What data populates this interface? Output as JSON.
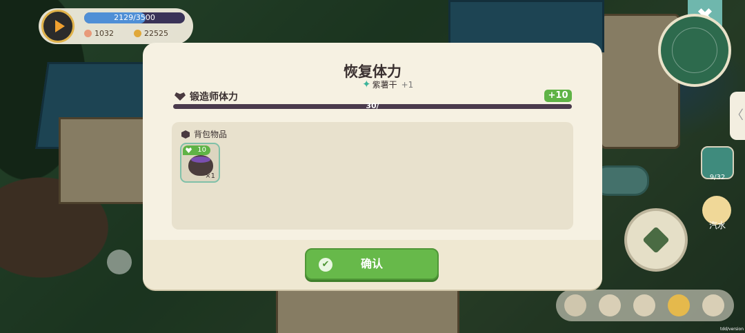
{
  "hud": {
    "exp_text": "2129/3500",
    "exp_progress": 0.608,
    "gems": "1032",
    "coins": "22525"
  },
  "side": {
    "close_symbol": "✖",
    "collapse_symbol": "〈",
    "bag_capacity": "9/32",
    "soda_label": "汽水"
  },
  "modal": {
    "title": "恢复体力",
    "toast_item": "紫薯干",
    "toast_plus": "+1",
    "stamina_label": "锻造师体力",
    "stamina_gain": "+10",
    "stamina_text": "30/",
    "bag_title": "背包物品",
    "items": [
      {
        "name": "purple-potion-pot",
        "badge": "10",
        "count": "×1"
      }
    ],
    "confirm_label": "确认"
  },
  "version": "tdd/version",
  "colors": {
    "accent_green": "#67b94a",
    "panel": "#f6f1e2",
    "teal": "#6fb7ad"
  }
}
